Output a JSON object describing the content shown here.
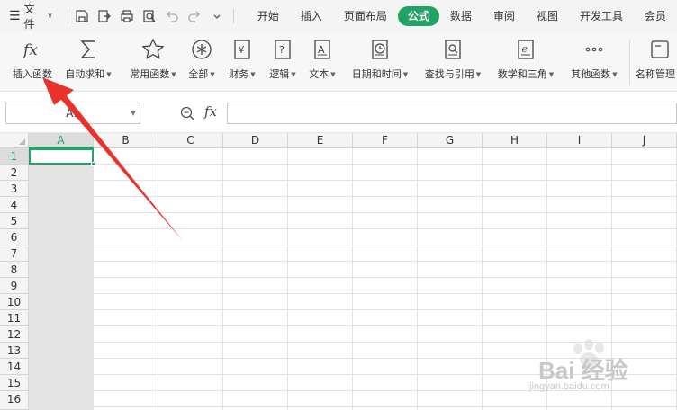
{
  "menubar": {
    "file_label": "文件",
    "tabs": [
      {
        "label": "开始",
        "active": false
      },
      {
        "label": "插入",
        "active": false
      },
      {
        "label": "页面布局",
        "active": false
      },
      {
        "label": "公式",
        "active": true
      },
      {
        "label": "数据",
        "active": false
      },
      {
        "label": "审阅",
        "active": false
      },
      {
        "label": "视图",
        "active": false
      },
      {
        "label": "开发工具",
        "active": false
      },
      {
        "label": "会员",
        "active": false
      }
    ]
  },
  "ribbon": {
    "insert_function": "插入函数",
    "autosum": "自动求和",
    "common": "常用函数",
    "all": "全部",
    "finance": "财务",
    "logic": "逻辑",
    "text": "文本",
    "datetime": "日期和时间",
    "lookup": "查找与引用",
    "math": "数学和三角",
    "other": "其他函数",
    "name_mgr": "名称管理"
  },
  "formula_bar": {
    "name_box": "A1",
    "fx_label": "fx",
    "formula": ""
  },
  "grid": {
    "columns": [
      "A",
      "B",
      "C",
      "D",
      "E",
      "F",
      "G",
      "H",
      "I",
      "J"
    ],
    "rows": [
      "1",
      "2",
      "3",
      "4",
      "5",
      "6",
      "7",
      "8",
      "9",
      "10",
      "11",
      "12",
      "13",
      "14",
      "15",
      "16"
    ],
    "selected_cell": "A1"
  },
  "annotation": {
    "arrow_color": "#e8322b"
  },
  "colors": {
    "accent": "#21a366"
  },
  "watermark": {
    "main": "Bai 经验",
    "url": "jingyan.baidu.com"
  }
}
